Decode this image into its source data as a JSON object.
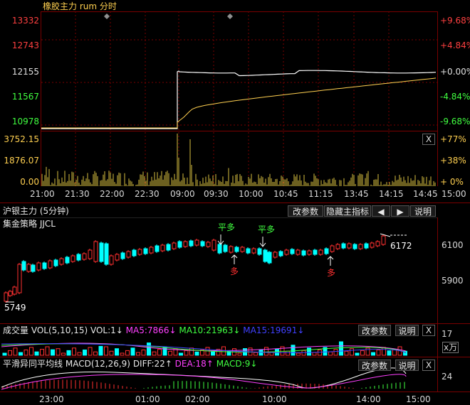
{
  "intraday": {
    "title": "橡胶主力 rum 分时",
    "left_prices": [
      "13332",
      "12743",
      "12155",
      "11567",
      "10978"
    ],
    "right_pcts": [
      "+9.68%",
      "+4.84%",
      "+0.00%",
      "-4.84%",
      "-9.68%"
    ],
    "vol_left": [
      "3752.15",
      "1876.07",
      "0.00"
    ],
    "vol_right": [
      "+77%",
      "+38%",
      "+ 0%"
    ],
    "close_btn": "X",
    "time_labels": [
      "21:00",
      "21:30",
      "22:00",
      "22:30",
      "09:00",
      "09:30",
      "10:00",
      "10:45",
      "11:15",
      "13:45",
      "14:15",
      "14:45",
      "15:00"
    ]
  },
  "kline": {
    "title": "沪银主力 (5分钟)",
    "strategy": "集金策略 JJCL",
    "buttons": {
      "change_params": "改参数",
      "hide_indicator": "隐藏主指标",
      "left_arrow": "◀",
      "right_arrow": "▶",
      "help": "说明"
    },
    "price_labels": [
      "6100",
      "5900"
    ],
    "high_label": "6172",
    "low_label": "5749",
    "signals": {
      "flat_long_1": "平多",
      "flat_long_2": "平多",
      "long_1": "多",
      "long_2": "多"
    }
  },
  "volume": {
    "label": "成交量",
    "formula": "VOL(5,10,15)",
    "vol_value": "VOL:1↓",
    "ma5": "MA5:7866↓",
    "ma10": "MA10:21963↓",
    "ma15": "MA15:19691↓",
    "right_value": "17",
    "unit": "x万",
    "buttons": {
      "change_params": "改参数",
      "help": "说明",
      "close": "X"
    }
  },
  "macd": {
    "label": "平滑异同平均线",
    "formula": "MACD(12,26,9)",
    "diff": "DIFF:22↑",
    "dea": "DEA:18↑",
    "macd": "MACD:9↓",
    "right_value": "24",
    "buttons": {
      "change_params": "改参数",
      "help": "说明",
      "close": "X"
    }
  },
  "bottom_axis": [
    "23:00",
    "01:00",
    "02:00",
    "10:00",
    "14:00",
    "15:00"
  ],
  "colors": {
    "up": "#ff3030",
    "down": "#00ffff",
    "price_line": "#ffffff",
    "avg_line": "#ffd050",
    "vol_bar": "#d8c040",
    "ma5": "#ff40ff",
    "ma10": "#40ff40",
    "ma15": "#4040ff",
    "diff": "#ffffff",
    "dea": "#ff40ff",
    "macd": "#40ff40",
    "grid": "#7a0000"
  }
}
